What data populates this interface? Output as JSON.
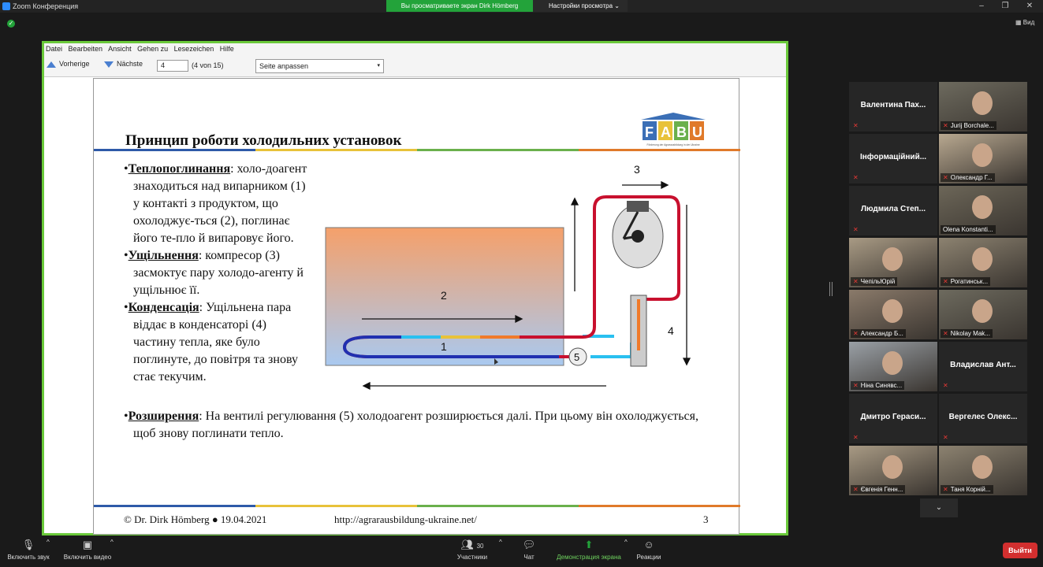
{
  "window": {
    "title": "Zoom Конференция",
    "share_banner": "Вы просматриваете экран Dirk Hömberg",
    "view_options": "Настройки просмотра",
    "view_button": "Вид"
  },
  "viewer": {
    "menu": [
      "Datei",
      "Bearbeiten",
      "Ansicht",
      "Gehen zu",
      "Lesezeichen",
      "Hilfe"
    ],
    "prev_label": "Vorherige",
    "next_label": "Nächste",
    "page_value": "4",
    "page_count": "(4 von 15)",
    "zoom_value": "Seite anpassen"
  },
  "slide": {
    "title": "Принцип роботи холодильних установок",
    "logo_text": "FABU",
    "logo_subtitle": "Förderung der Agrarausbildung in der Ukraine",
    "bullets": [
      {
        "term": "Теплопоглинання",
        "text": ": холо-доагент знаходиться над випарником (1) у контакті з продуктом, що охолоджує-ться (2), поглинає його те-пло й випаровує його."
      },
      {
        "term": "Ущільнення",
        "text": ": компресор (3) засмоктує пару холодо-агенту й ущільнює її."
      },
      {
        "term": "Конденсація",
        "text": ": Ущільнена пара віддає в конденсаторі (4) частину тепла, яке було поглинуте, до повітря та знову стає текучим."
      },
      {
        "term": "Розширення",
        "text": ": На вентилі регулювання (5) холодоагент розширюється далі. При цьому він охолоджується, щоб знову поглинати тепло."
      }
    ],
    "diagram_labels": {
      "l1": "1",
      "l2": "2",
      "l3": "3",
      "l4": "4",
      "l5": "5"
    },
    "footer_author": "© Dr. Dirk Hömberg ● 19.04.2021",
    "footer_url": "http://agrarausbildung-ukraine.net/",
    "footer_page": "3"
  },
  "participants": [
    {
      "name": "Валентина Пах...",
      "video": false,
      "muted": true
    },
    {
      "name": "Jurij Borchale...",
      "video": true,
      "muted": true
    },
    {
      "name": "Інформаційний...",
      "video": false,
      "muted": true
    },
    {
      "name": "Олександр Г...",
      "video": true,
      "muted": true
    },
    {
      "name": "Людмила Степ...",
      "video": false,
      "muted": true
    },
    {
      "name": "Olena Konstanti...",
      "video": true,
      "muted": false,
      "active": true
    },
    {
      "name": "ЧепільЮрій",
      "video": true,
      "muted": true
    },
    {
      "name": "Рогатинськ...",
      "video": true,
      "muted": true
    },
    {
      "name": "Александр Б...",
      "video": true,
      "muted": true
    },
    {
      "name": "Nikolay Mak...",
      "video": true,
      "muted": true
    },
    {
      "name": "Ніна Синявс...",
      "video": true,
      "muted": true
    },
    {
      "name": "Владислав Ант...",
      "video": false,
      "muted": true
    },
    {
      "name": "Дмитро Гераси...",
      "video": false,
      "muted": true
    },
    {
      "name": "Вергелес Олекс...",
      "video": false,
      "muted": true
    },
    {
      "name": "Євгенія Генн...",
      "video": true,
      "muted": true
    },
    {
      "name": "Таня Корній...",
      "video": true,
      "muted": true
    }
  ],
  "controls": {
    "mute_label": "Включить звук",
    "video_label": "Включить видео",
    "participants_label": "Участники",
    "participants_count": "30",
    "chat_label": "Чат",
    "share_label": "Демонстрация экрана",
    "reactions_label": "Реакции",
    "leave_label": "Выйти"
  },
  "colors": {
    "share_green": "#23a33a",
    "frame_green": "#6ac93a",
    "leave_red": "#d32f2f",
    "stripe": [
      "#2e5aa8",
      "#e8c23a",
      "#6ab04c",
      "#e07a2a"
    ]
  }
}
